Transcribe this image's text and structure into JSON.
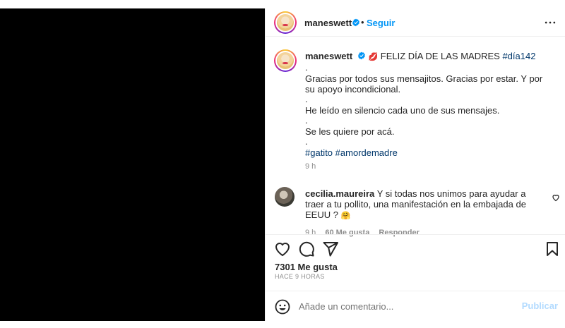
{
  "header": {
    "username": "maneswett",
    "separator": "•",
    "follow_label": "Seguir",
    "more_icon": "more-horizontal-icon"
  },
  "caption": {
    "username": "maneswett",
    "title_emoji": "💋",
    "title": "FELIZ DÍA DE LAS MADRES",
    "title_tag": "#día142",
    "lines": [
      ".",
      "Gracias por todos sus mensajitos. Gracias por estar. Y por su apoyo incondicional.",
      ".",
      "He leído en silencio cada uno de sus mensajes.",
      ".",
      "Se les quiere por acá.",
      "."
    ],
    "tags": [
      "#gatito",
      "#amordemadre"
    ],
    "time": "9 h"
  },
  "comment": {
    "username": "cecilia.maureira",
    "text": "Y si todas nos unimos para ayudar a traer a tu pollito, una manifestación en la embajada de EEUU ?",
    "emoji": "🤗",
    "time": "9 h",
    "likes": "60 Me gusta",
    "reply_label": "Responder"
  },
  "stats": {
    "likes": "7301 Me gusta",
    "time_ago": "HACE 9 HORAS"
  },
  "comment_box": {
    "placeholder": "Añade un comentario...",
    "publish_label": "Publicar"
  },
  "colors": {
    "accent": "#0095f6",
    "publish_disabled": "#b3dbff",
    "hashtag": "#00376b",
    "muted": "#8e8e8e"
  }
}
